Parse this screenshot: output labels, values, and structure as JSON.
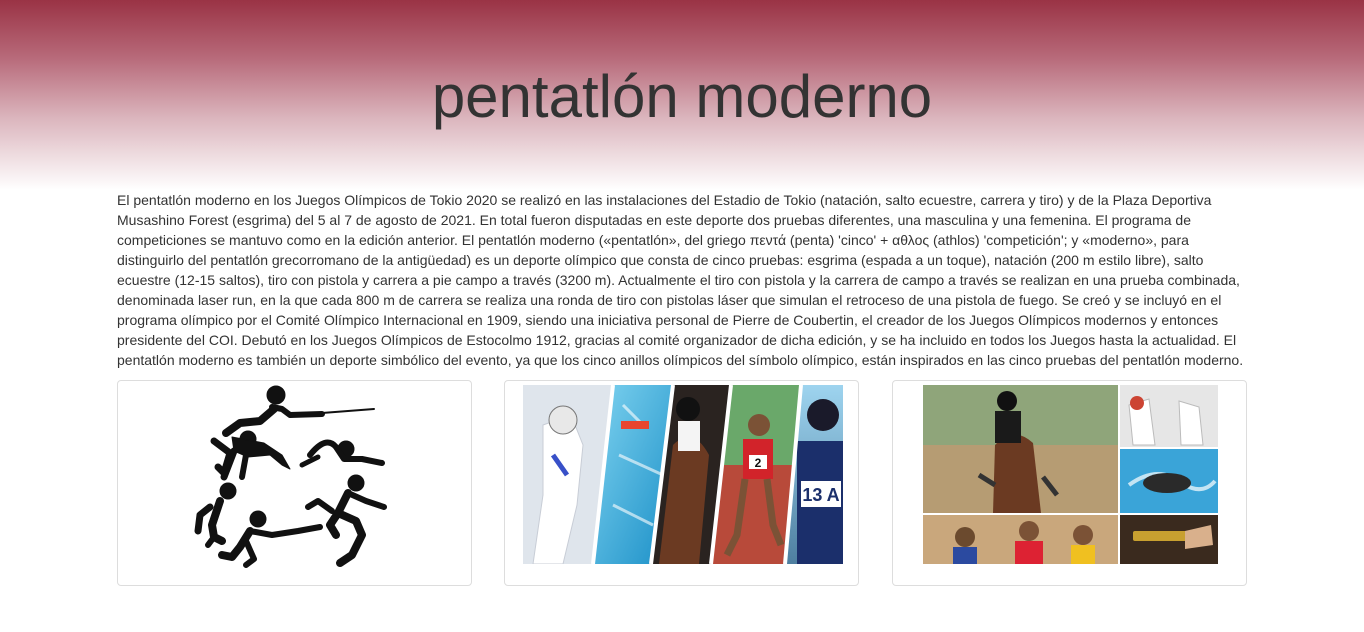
{
  "header": {
    "title": "pentatlón moderno"
  },
  "intro": {
    "text": "El pentatlón moderno en los Juegos Olímpicos de Tokio 2020 se realizó en las instalaciones del Estadio de Tokio (natación, salto ecuestre, carrera y tiro) y de la Plaza Deportiva Musashino Forest (esgrima) del 5 al 7 de agosto de 2021. En total fueron disputadas en este deporte dos pruebas diferentes, una masculina y una femenina. El programa de competiciones se mantuvo como en la edición anterior. El pentatlón moderno («pentatlón», del griego πεντά (penta) 'cinco' + αθλος (athlos) 'competición'; y «moderno», para distinguirlo del pentatlón grecorromano de la antigüedad) es un deporte olímpico que consta de cinco pruebas: esgrima (espada a un toque), natación (200 m estilo libre), salto ecuestre (12-15 saltos), tiro con pistola y carrera a pie campo a través (3200 m). Actualmente el tiro con pistola y la carrera de campo a través se realizan en una prueba combinada, denominada laser run, en la que cada 800 m de carrera se realiza una ronda de tiro con pistolas láser que simulan el retroceso de una pistola de fuego. Se creó y se incluyó en el programa olímpico por el Comité Olímpico Internacional en 1909, siendo una iniciativa personal de Pierre de Coubertin, el creador de los Juegos Olímpicos modernos y entonces presidente del COI. Debutó en los Juegos Olímpicos de Estocolmo 1912, gracias al comité organizador de dicha edición, y se ha incluido en todos los Juegos hasta la actualidad. El pentatlón moderno es también un deporte simbólico del evento, ya que los cinco anillos olímpicos del símbolo olímpico, están inspirados en las cinco pruebas del pentatlón moderno."
  },
  "gallery": {
    "images": [
      {
        "icon": "pentathlon-pictogram-image"
      },
      {
        "icon": "pentathlon-athletes-collage-image",
        "bibs": [
          "2",
          "13 A"
        ]
      },
      {
        "icon": "pentathlon-events-collage-image"
      }
    ]
  },
  "colors": {
    "hero_top": "#9a3345",
    "hero_bottom": "#ffffff",
    "text": "#333333",
    "card_border": "#dddddd"
  }
}
